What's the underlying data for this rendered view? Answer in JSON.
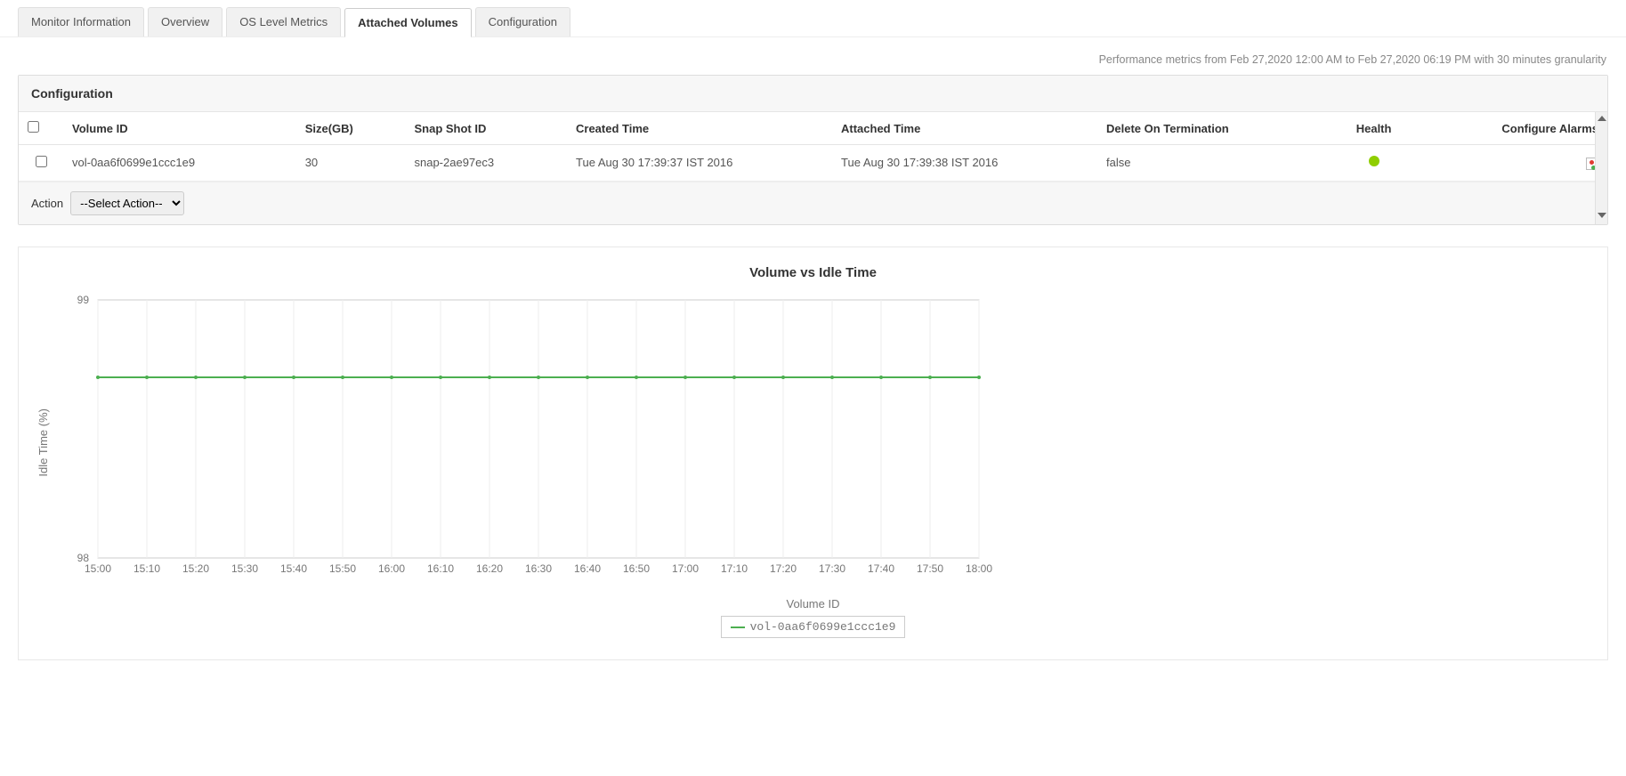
{
  "tabs": [
    "Monitor Information",
    "Overview",
    "OS Level Metrics",
    "Attached Volumes",
    "Configuration"
  ],
  "active_tab_index": 3,
  "metrics_note": "Performance metrics from Feb 27,2020 12:00 AM to Feb 27,2020 06:19 PM with 30 minutes granularity",
  "config_panel": {
    "title": "Configuration",
    "headers": [
      "Volume ID",
      "Size(GB)",
      "Snap Shot ID",
      "Created Time",
      "Attached Time",
      "Delete On Termination",
      "Health",
      "Configure Alarms"
    ],
    "rows": [
      {
        "volume_id": "vol-0aa6f0699e1ccc1e9",
        "size_gb": "30",
        "snapshot_id": "snap-2ae97ec3",
        "created_time": "Tue Aug 30 17:39:37 IST 2016",
        "attached_time": "Tue Aug 30 17:39:38 IST 2016",
        "delete_on_termination": "false",
        "health": "green"
      }
    ],
    "action_label": "Action",
    "action_select": "--Select Action--"
  },
  "chart_data": {
    "type": "line",
    "title": "Volume vs Idle Time",
    "xlabel": "Volume ID",
    "ylabel": "Idle Time (%)",
    "ylim": [
      98,
      99
    ],
    "yticks": [
      98,
      99
    ],
    "categories": [
      "15:00",
      "15:10",
      "15:20",
      "15:30",
      "15:40",
      "15:50",
      "16:00",
      "16:10",
      "16:20",
      "16:30",
      "16:40",
      "16:50",
      "17:00",
      "17:10",
      "17:20",
      "17:30",
      "17:40",
      "17:50",
      "18:00"
    ],
    "series": [
      {
        "name": "vol-0aa6f0699e1ccc1e9",
        "color": "#4caf50",
        "values": [
          98.7,
          98.7,
          98.7,
          98.7,
          98.7,
          98.7,
          98.7,
          98.7,
          98.7,
          98.7,
          98.7,
          98.7,
          98.7,
          98.7,
          98.7,
          98.7,
          98.7,
          98.7,
          98.7
        ]
      }
    ]
  }
}
